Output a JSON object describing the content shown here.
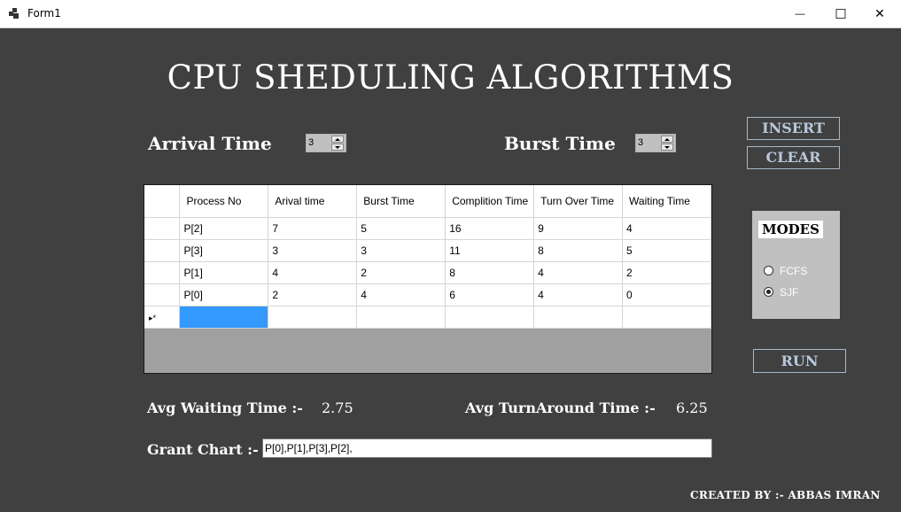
{
  "window": {
    "title": "Form1",
    "minimize": "—",
    "maximize": "☐",
    "close": "✕"
  },
  "title": "CPU SHEDULING ALGORITHMS",
  "arrival": {
    "label": "Arrival Time",
    "value": "3"
  },
  "burst": {
    "label": "Burst Time",
    "value": "3"
  },
  "buttons": {
    "insert": "INSERT",
    "clear": "CLEAR",
    "run": "RUN"
  },
  "grid": {
    "columns": [
      "Process No",
      "Arival time",
      "Burst Time",
      "Complition Time",
      "Turn Over Time",
      "Waiting Time"
    ],
    "rows": [
      [
        "P[2]",
        "7",
        "5",
        "16",
        "9",
        "4"
      ],
      [
        "P[3]",
        "3",
        "3",
        "11",
        "8",
        "5"
      ],
      [
        "P[1]",
        "4",
        "2",
        "8",
        "4",
        "2"
      ],
      [
        "P[0]",
        "2",
        "4",
        "6",
        "4",
        "0"
      ]
    ],
    "new_row_marker": "▸*"
  },
  "modes": {
    "title": "MODES",
    "options": [
      {
        "label": "FCFS",
        "checked": false
      },
      {
        "label": "SJF",
        "checked": true
      }
    ]
  },
  "avg_waiting": {
    "label": "Avg Waiting Time :-",
    "value": "2.75"
  },
  "avg_turnaround": {
    "label": "Avg TurnAround Time :-",
    "value": "6.25"
  },
  "gantt": {
    "label": "Grant Chart :-",
    "value": "P[0],P[1],P[3],P[2],"
  },
  "credit": "CREATED BY :- ABBAS IMRAN"
}
